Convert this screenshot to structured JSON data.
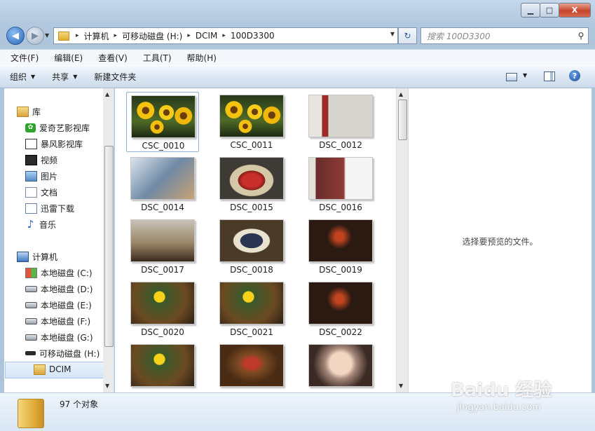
{
  "window_controls": {
    "minimize": "▁",
    "maximize": "□",
    "close": "X"
  },
  "address": {
    "crumbs": [
      "计算机",
      "可移动磁盘 (H:)",
      "DCIM",
      "100D3300"
    ],
    "separator": "▸"
  },
  "search": {
    "placeholder": "搜索 100D3300"
  },
  "menu": [
    "文件(F)",
    "编辑(E)",
    "查看(V)",
    "工具(T)",
    "帮助(H)"
  ],
  "toolbar": {
    "organize": "组织",
    "share": "共享",
    "new_folder": "新建文件夹"
  },
  "nav": {
    "library": "库",
    "library_items": [
      "爱奇艺影视库",
      "暴风影视库",
      "视频",
      "图片",
      "文档",
      "迅雷下载",
      "音乐"
    ],
    "computer": "计算机",
    "drives": [
      "本地磁盘 (C:)",
      "本地磁盘 (D:)",
      "本地磁盘 (E:)",
      "本地磁盘 (F:)",
      "本地磁盘 (G:)",
      "可移动磁盘 (H:)"
    ],
    "selected_folder": "DCIM"
  },
  "files": [
    {
      "name": "CSC_0010",
      "thumb": "t-sun"
    },
    {
      "name": "CSC_0011",
      "thumb": "t-sun"
    },
    {
      "name": "DSC_0012",
      "thumb": "t-bike"
    },
    {
      "name": "DSC_0014",
      "thumb": "t-book"
    },
    {
      "name": "DSC_0015",
      "thumb": "t-red"
    },
    {
      "name": "DSC_0016",
      "thumb": "t-shelf"
    },
    {
      "name": "DSC_0017",
      "thumb": "t-fig"
    },
    {
      "name": "DSC_0018",
      "thumb": "t-grad"
    },
    {
      "name": "DSC_0019",
      "thumb": "t-cage"
    },
    {
      "name": "DSC_0020",
      "thumb": "t-smile"
    },
    {
      "name": "DSC_0021",
      "thumb": "t-smile"
    },
    {
      "name": "DSC_0022",
      "thumb": "t-cage"
    },
    {
      "name": "",
      "thumb": "t-smile"
    },
    {
      "name": "",
      "thumb": "t-onepiece"
    },
    {
      "name": "",
      "thumb": "t-doll"
    }
  ],
  "preview": {
    "message": "选择要预览的文件。"
  },
  "status": {
    "count": "97 个对象"
  },
  "watermark": {
    "main": "Baidu 经验",
    "sub": "jingyan.baidu.com"
  }
}
